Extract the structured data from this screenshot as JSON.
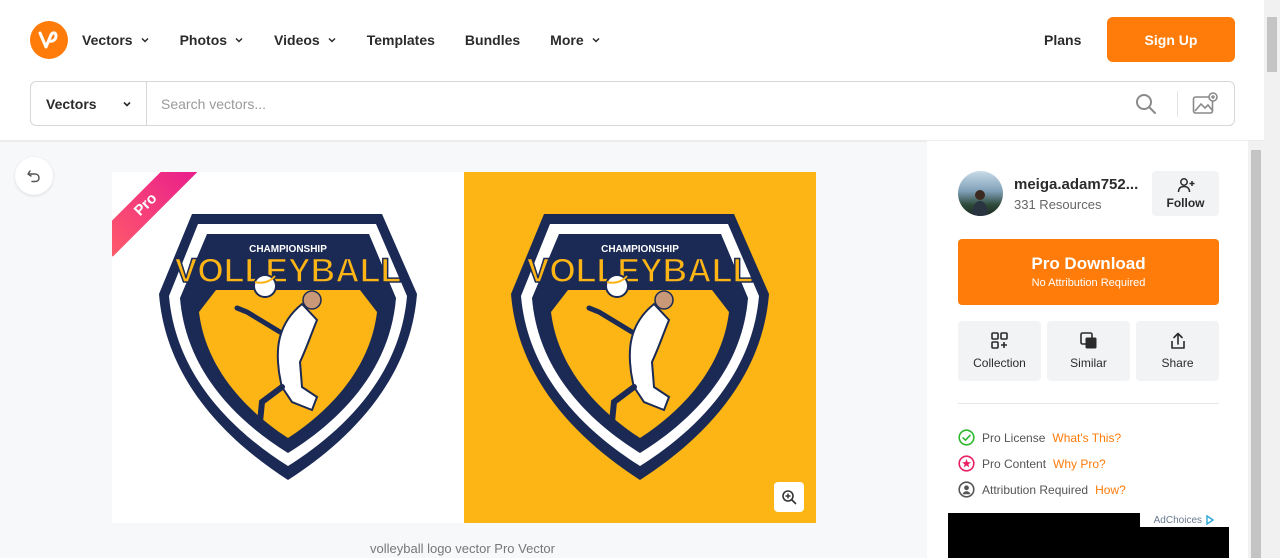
{
  "brand": {
    "logo_icon": "vecteezy-logo-icon",
    "accent": "#ff7c0a"
  },
  "nav": {
    "items": [
      {
        "label": "Vectors",
        "dropdown": true
      },
      {
        "label": "Photos",
        "dropdown": true
      },
      {
        "label": "Videos",
        "dropdown": true
      },
      {
        "label": "Templates",
        "dropdown": false
      },
      {
        "label": "Bundles",
        "dropdown": false
      },
      {
        "label": "More",
        "dropdown": true
      }
    ],
    "plans": "Plans",
    "signup": "Sign Up"
  },
  "search": {
    "type": "Vectors",
    "placeholder": "Search vectors...",
    "value": ""
  },
  "preview": {
    "badge": "Pro",
    "logo_top": "CHAMPIONSHIP",
    "logo_main": "VOLLEYBALL",
    "caption": "volleyball logo vector Pro Vector"
  },
  "author": {
    "name": "meiga.adam752...",
    "resources": "331 Resources",
    "follow": "Follow"
  },
  "download": {
    "main": "Pro Download",
    "sub": "No Attribution Required"
  },
  "actions": [
    {
      "label": "Collection",
      "icon": "collection-icon"
    },
    {
      "label": "Similar",
      "icon": "similar-icon"
    },
    {
      "label": "Share",
      "icon": "share-icon"
    }
  ],
  "license": [
    {
      "text": "Pro License",
      "link": "What's This?",
      "icon": "check-circle-icon",
      "color": "#2eb82e"
    },
    {
      "text": "Pro Content",
      "link": "Why Pro?",
      "icon": "star-circle-icon",
      "color": "#e91e63"
    },
    {
      "text": "Attribution Required",
      "link": "How?",
      "icon": "user-circle-icon",
      "color": "#555555"
    }
  ],
  "ad": {
    "label": "AdChoices"
  }
}
